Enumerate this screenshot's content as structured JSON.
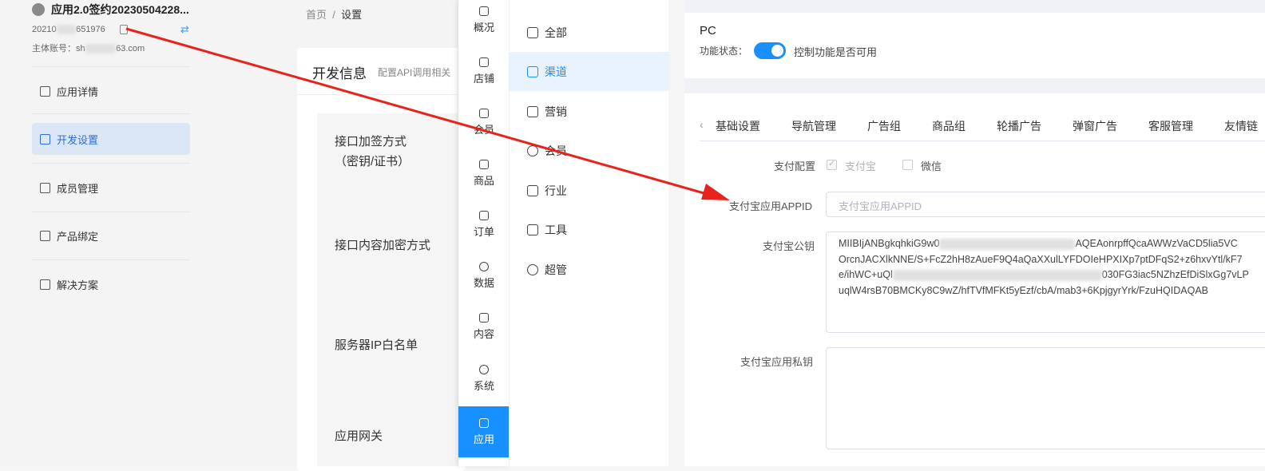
{
  "app": {
    "title": "应用2.0签约20230504228...",
    "id_prefix": "20210",
    "id_suffix": "651976",
    "account_prefix": "主体账号：sh",
    "account_suffix": "63.com"
  },
  "sidebar": {
    "items": [
      {
        "label": "应用详情",
        "icon": "app-detail-icon"
      },
      {
        "label": "开发设置",
        "icon": "dev-settings-icon",
        "active": true
      },
      {
        "label": "成员管理",
        "icon": "members-icon"
      },
      {
        "label": "产品绑定",
        "icon": "product-bind-icon"
      },
      {
        "label": "解决方案",
        "icon": "solution-icon"
      }
    ]
  },
  "breadcrumb": {
    "home": "首页",
    "sep": "/",
    "current": "设置"
  },
  "dev_card": {
    "title": "开发信息",
    "subtitle": "配置API调用相关",
    "labels": {
      "sign_method_1": "接口加签方式",
      "sign_method_2": "（密钥/证书）",
      "encrypt": "接口内容加密方式",
      "ip_whitelist": "服务器IP白名单",
      "gateway": "应用网关"
    }
  },
  "rail": {
    "items": [
      {
        "label": "概况",
        "icon": "dashboard-icon"
      },
      {
        "label": "店铺",
        "icon": "shop-icon"
      },
      {
        "label": "会员",
        "icon": "member-icon"
      },
      {
        "label": "商品",
        "icon": "goods-icon"
      },
      {
        "label": "订单",
        "icon": "order-icon"
      },
      {
        "label": "数据",
        "icon": "data-icon"
      },
      {
        "label": "内容",
        "icon": "content-icon"
      },
      {
        "label": "系统",
        "icon": "system-icon"
      },
      {
        "label": "应用",
        "icon": "app-icon",
        "active": true
      }
    ]
  },
  "submenu": {
    "items": [
      {
        "label": "全部",
        "icon": "all-icon"
      },
      {
        "label": "渠道",
        "icon": "channel-icon",
        "active": true
      },
      {
        "label": "营销",
        "icon": "marketing-icon"
      },
      {
        "label": "会员",
        "icon": "member-icon"
      },
      {
        "label": "行业",
        "icon": "industry-icon"
      },
      {
        "label": "工具",
        "icon": "tool-icon"
      },
      {
        "label": "超管",
        "icon": "admin-icon"
      }
    ]
  },
  "pc": {
    "title": "PC",
    "status_label": "功能状态：",
    "status_on": true,
    "status_desc": "控制功能是否可用"
  },
  "tabs": [
    "基础设置",
    "导航管理",
    "广告组",
    "商品组",
    "轮播广告",
    "弹窗广告",
    "客服管理",
    "友情链"
  ],
  "form": {
    "pay_config_label": "支付配置",
    "alipay": {
      "label": "支付宝",
      "checked": true
    },
    "wechat": {
      "label": "微信",
      "checked": false
    },
    "appid_label": "支付宝应用APPID",
    "appid_placeholder": "支付宝应用APPID",
    "pubkey_label": "支付宝公钥",
    "pubkey_lines": [
      "MIIBIjANBgkqhkiG9w0",
      "AQEAonrpffQcaAWWzVaCD5lia5VC",
      "OrcnJACXlkNNE/S+FcZ2hH8zAueF9Q4aQaXXulLYFDOIeHPXIXp7ptDFqS2+z6hxvYtl/kF7",
      "e/ihWC+uQl",
      "030FG3iac5NZhzEfDiSlxGg7vLP",
      "uqlW4rsB70BMCKy8C9wZ/hfTVfMFKt5yEzf/cbA/mab3+6KpjgyrYrk/FzuHQIDAQAB"
    ],
    "privkey_label": "支付宝应用私钥"
  },
  "colors": {
    "accent": "#1890ff",
    "annotation_arrow": "#e8231b"
  }
}
